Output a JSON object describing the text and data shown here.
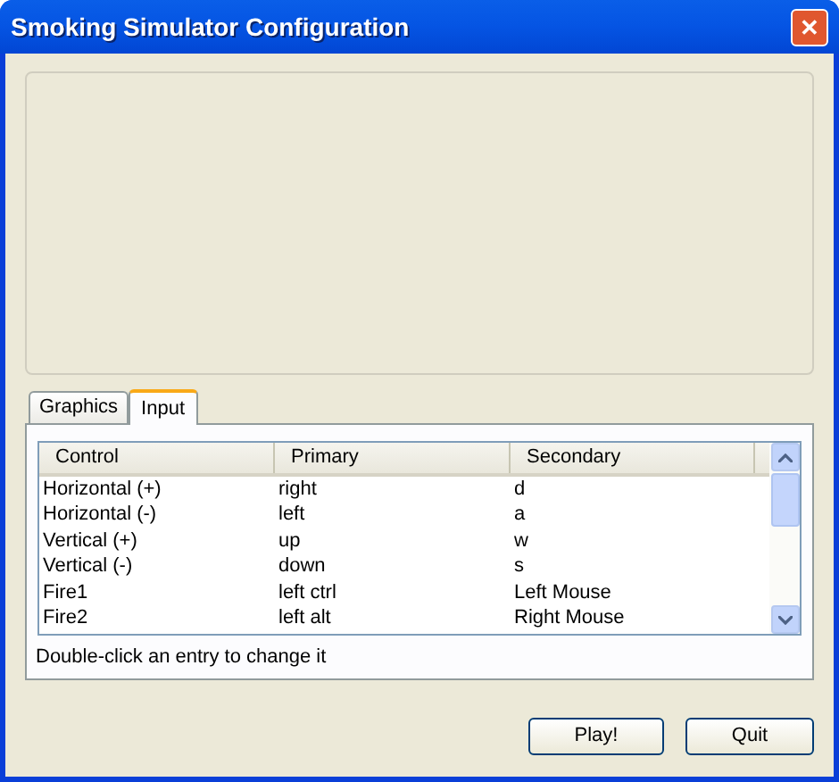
{
  "window": {
    "title": "Smoking Simulator Configuration",
    "close": "✕"
  },
  "tabs": [
    {
      "label": "Graphics",
      "selected": false
    },
    {
      "label": "Input",
      "selected": true
    }
  ],
  "table": {
    "columns": [
      "Control",
      "Primary",
      "Secondary"
    ],
    "rows": [
      [
        "Horizontal (+)",
        "right",
        "d"
      ],
      [
        "Horizontal (-)",
        "left",
        "a"
      ],
      [
        "Vertical (+)",
        "up",
        "w"
      ],
      [
        "Vertical (-)",
        "down",
        "s"
      ],
      [
        "Fire1",
        "left ctrl",
        "Left Mouse"
      ],
      [
        "Fire2",
        "left alt",
        "Right Mouse"
      ]
    ]
  },
  "hint": "Double-click an entry to change it",
  "buttons": [
    "Play!",
    "Quit"
  ]
}
